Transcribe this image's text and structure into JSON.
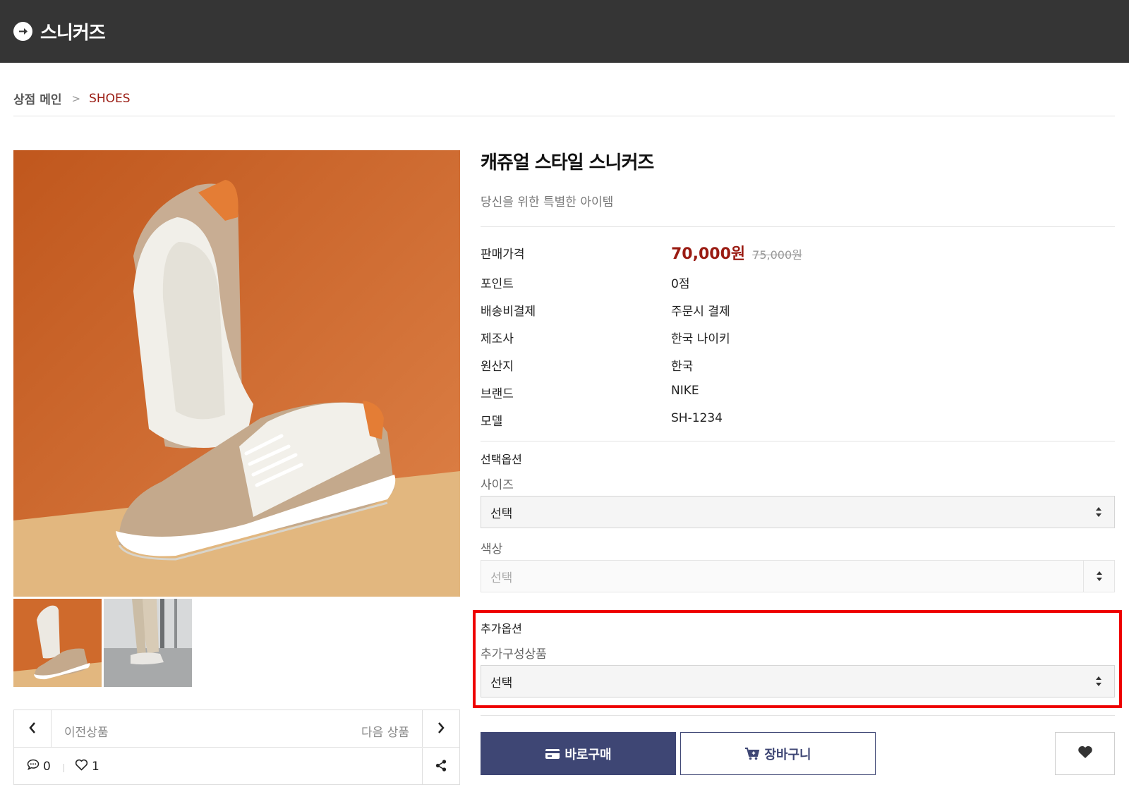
{
  "header": {
    "title": "스니커즈",
    "icon": "arrow-circle-right-icon"
  },
  "breadcrumb": {
    "home": "상점 메인",
    "separator": ">",
    "current": "SHOES",
    "current_color": "#9a1b12"
  },
  "gallery": {
    "main_image_alt": "shoe-photo",
    "thumbnails": [
      "shoe-photo-thumbnail",
      "model-legs-thumbnail"
    ]
  },
  "navigation": {
    "prev_label": "이전상품",
    "next_label": "다음 상품"
  },
  "stats": {
    "comments": "0",
    "likes": "1"
  },
  "product": {
    "name": "캐쥬얼 스타일 스니커즈",
    "summary": "당신을 위한 특별한 아이템",
    "sale_price": "70,000원",
    "original_price": "75,000원",
    "info": [
      {
        "label": "판매가격",
        "value": ""
      },
      {
        "label": "포인트",
        "value": "0점"
      },
      {
        "label": "배송비결제",
        "value": "주문시 결제"
      },
      {
        "label": "제조사",
        "value": "한국 나이키"
      },
      {
        "label": "원산지",
        "value": "한국"
      },
      {
        "label": "브랜드",
        "value": "NIKE"
      },
      {
        "label": "모델",
        "value": "SH-1234"
      }
    ]
  },
  "options": {
    "title": "선택옵션",
    "size": {
      "label": "사이즈",
      "value": "선택"
    },
    "color": {
      "label": "색상",
      "value": "선택"
    }
  },
  "extra_options": {
    "title": "추가옵션",
    "label": "추가구성상품",
    "value": "선택"
  },
  "actions": {
    "buy_label": "바로구매",
    "cart_label": "장바구니"
  },
  "colors": {
    "accent": "#3e4674",
    "price": "#9a1b12",
    "header_bg": "#353535",
    "highlight": "#ee0000"
  }
}
